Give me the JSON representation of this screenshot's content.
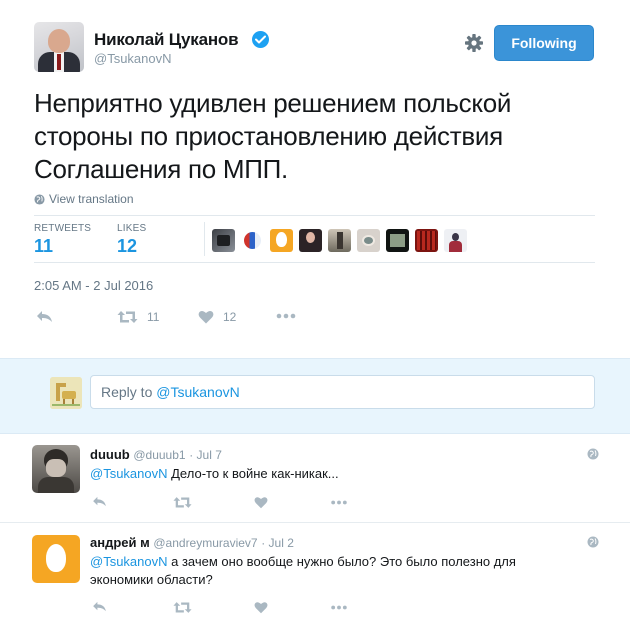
{
  "tweet": {
    "author_name": "Николай Цуканов",
    "author_handle": "@TsukanovN",
    "follow_label": "Following",
    "text": "Неприятно удивлен решением польской стороны по приостановлению действия Соглашения по МПП.",
    "translate_label": "View translation",
    "retweets_label": "RETWEETS",
    "retweets_count": "11",
    "likes_label": "LIKES",
    "likes_count": "12",
    "timestamp": "2:05 AM - 2 Jul 2016",
    "action_retweet_count": "11",
    "action_like_count": "12",
    "likers": [
      "liker-1",
      "liker-2",
      "liker-3",
      "liker-4",
      "liker-5",
      "liker-6",
      "liker-7",
      "liker-8",
      "liker-9",
      "liker-10"
    ],
    "colors": {
      "accent": "#1b95e0",
      "follow_bg": "#3b94d9",
      "verified": "#1da1f2"
    }
  },
  "reply_box": {
    "prefix": "Reply to ",
    "mention": "@TsukanovN"
  },
  "replies": [
    {
      "name": "duuub",
      "handle": "@duuub1",
      "date": "· Jul 7",
      "mention": "@TsukanovN",
      "text": " Дело-то к войне как-никак..."
    },
    {
      "name": "андрей м",
      "handle": "@andreymuraviev7",
      "date": "· Jul 2",
      "mention": "@TsukanovN",
      "text": " а зачем оно вообще нужно было? Это было полезно для экономики области?"
    }
  ],
  "icons": [
    "gear-icon",
    "verified-icon",
    "globe-icon",
    "reply-icon",
    "retweet-icon",
    "heart-icon",
    "more-icon"
  ]
}
